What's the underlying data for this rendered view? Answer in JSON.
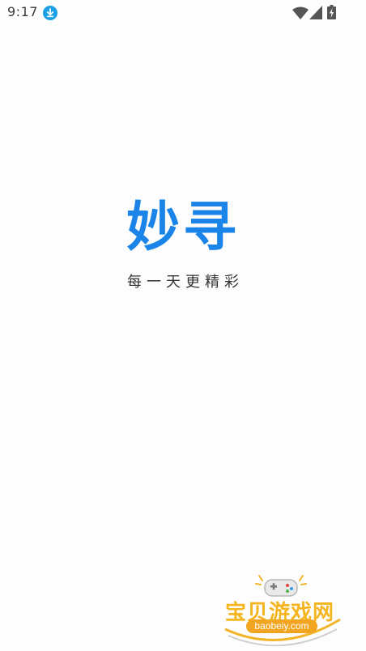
{
  "status_bar": {
    "time": "9:17",
    "icons": [
      "download-icon",
      "wifi-icon",
      "signal-icon",
      "battery-icon"
    ]
  },
  "splash": {
    "logo_text": "妙寻",
    "slogan": "每一天更精彩",
    "logo_color": "#1a84e8"
  },
  "watermark": {
    "name": "宝贝游戏网",
    "url": "baobeiy.com",
    "color": "#f5b51f"
  }
}
